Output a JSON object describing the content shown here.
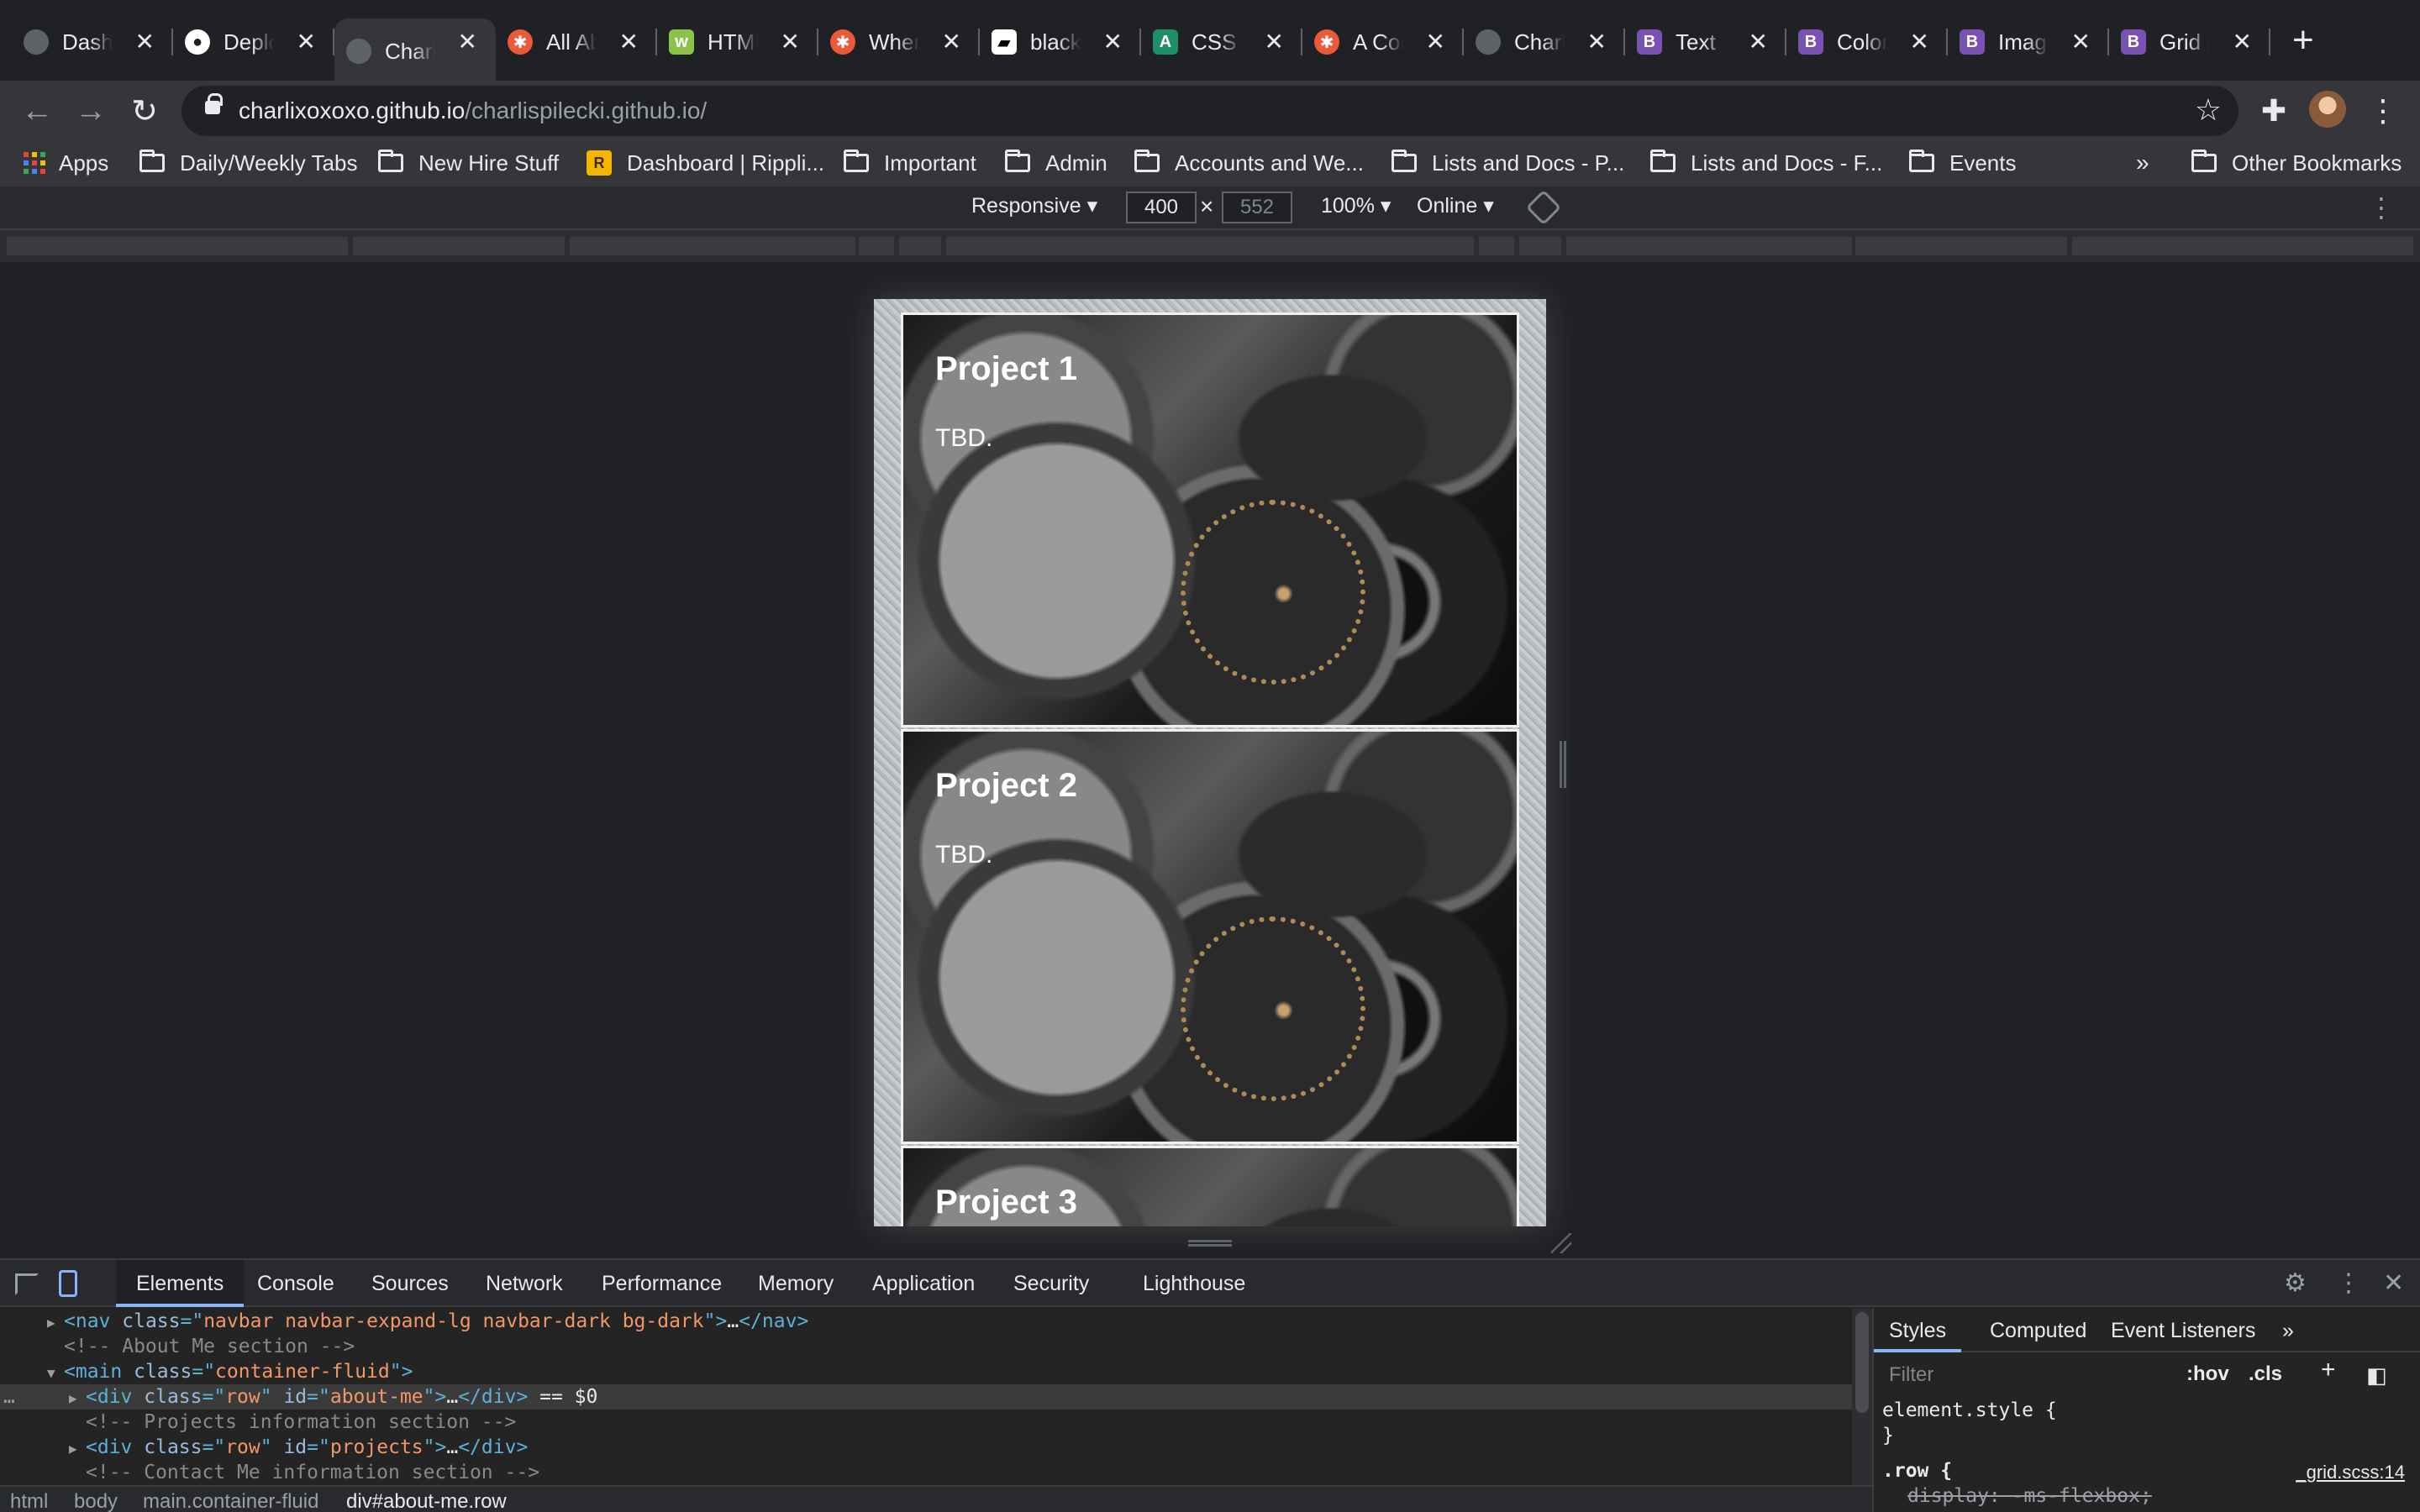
{
  "tabs": [
    {
      "title": "Dashbo",
      "favicon": "globe-icon"
    },
    {
      "title": "Deploy",
      "favicon": "github-icon"
    },
    {
      "title": "Charlie",
      "favicon": "globe-icon",
      "active": true
    },
    {
      "title": "All Abo",
      "favicon": "orange-burst-icon"
    },
    {
      "title": "HTML",
      "favicon": "w3-icon"
    },
    {
      "title": "When",
      "favicon": "orange-burst-icon"
    },
    {
      "title": "black",
      "favicon": "unsplash-icon"
    },
    {
      "title": "CSS b",
      "favicon": "teal-icon"
    },
    {
      "title": "A Com",
      "favicon": "orange-burst-icon"
    },
    {
      "title": "Charlie",
      "favicon": "globe-icon"
    },
    {
      "title": "Text ·",
      "favicon": "bootstrap-icon"
    },
    {
      "title": "Colors",
      "favicon": "bootstrap-icon"
    },
    {
      "title": "Images",
      "favicon": "bootstrap-icon"
    },
    {
      "title": "Grid s",
      "favicon": "bootstrap-icon"
    }
  ],
  "address": {
    "host": "charlixoxoxo.github.io",
    "path": "/charlispilecki.github.io/"
  },
  "bookmarks": {
    "apps": "Apps",
    "items": [
      "Daily/Weekly Tabs",
      "New Hire Stuff",
      "Dashboard | Rippli...",
      "Important",
      "Admin",
      "Accounts and We...",
      "Lists and Docs - P...",
      "Lists and Docs - F...",
      "Events"
    ],
    "overflow": "»",
    "other": "Other Bookmarks"
  },
  "device_toolbar": {
    "mode": "Responsive ▾",
    "width": "400",
    "height": "552",
    "times": "×",
    "zoom": "100% ▾",
    "network": "Online ▾"
  },
  "page": {
    "cards": [
      {
        "title": "Project 1",
        "text": "TBD."
      },
      {
        "title": "Project 2",
        "text": "TBD."
      },
      {
        "title": "Project 3",
        "text": ""
      }
    ]
  },
  "devtools": {
    "tabs": [
      "Elements",
      "Console",
      "Sources",
      "Network",
      "Performance",
      "Memory",
      "Application",
      "Security",
      "Lighthouse"
    ],
    "active_tab": "Elements",
    "dom_lines": [
      {
        "indent": 1,
        "arrow": "▶",
        "html": "nav",
        "parts": [
          [
            "tag",
            "<nav "
          ],
          [
            "attr",
            "class"
          ],
          [
            "tag",
            "=\""
          ],
          [
            "val",
            "navbar navbar-expand-lg navbar-dark bg-dark"
          ],
          [
            "tag",
            "\">"
          ],
          [
            "txt",
            "…"
          ],
          [
            "tag",
            "</nav>"
          ]
        ]
      },
      {
        "indent": 1,
        "arrow": "",
        "parts": [
          [
            "cmt",
            "<!-- About Me section -->"
          ]
        ]
      },
      {
        "indent": 1,
        "arrow": "▼",
        "parts": [
          [
            "tag",
            "<main "
          ],
          [
            "attr",
            "class"
          ],
          [
            "tag",
            "=\""
          ],
          [
            "val",
            "container-fluid"
          ],
          [
            "tag",
            "\">"
          ]
        ]
      },
      {
        "indent": 2,
        "arrow": "▶",
        "selected": true,
        "parts": [
          [
            "tag",
            "<div "
          ],
          [
            "attr",
            "class"
          ],
          [
            "tag",
            "=\""
          ],
          [
            "val",
            "row"
          ],
          [
            "tag",
            "\" "
          ],
          [
            "attr",
            "id"
          ],
          [
            "tag",
            "=\""
          ],
          [
            "val",
            "about-me"
          ],
          [
            "tag",
            "\">"
          ],
          [
            "txt",
            "…"
          ],
          [
            "tag",
            "</div>"
          ],
          [
            "txt",
            " == $0"
          ]
        ]
      },
      {
        "indent": 2,
        "arrow": "",
        "parts": [
          [
            "cmt",
            "<!-- Projects information section -->"
          ]
        ]
      },
      {
        "indent": 2,
        "arrow": "▶",
        "parts": [
          [
            "tag",
            "<div "
          ],
          [
            "attr",
            "class"
          ],
          [
            "tag",
            "=\""
          ],
          [
            "val",
            "row"
          ],
          [
            "tag",
            "\" "
          ],
          [
            "attr",
            "id"
          ],
          [
            "tag",
            "=\""
          ],
          [
            "val",
            "projects"
          ],
          [
            "tag",
            "\">"
          ],
          [
            "txt",
            "…"
          ],
          [
            "tag",
            "</div>"
          ]
        ]
      },
      {
        "indent": 2,
        "arrow": "",
        "parts": [
          [
            "cmt",
            "<!-- Contact Me information section -->"
          ]
        ]
      }
    ],
    "breadcrumbs": [
      "html",
      "body",
      "main.container-fluid",
      "div#about-me.row"
    ],
    "styles": {
      "tabs": [
        "Styles",
        "Computed",
        "Event Listeners",
        "»"
      ],
      "filter_placeholder": "Filter",
      "hov": ":hov",
      "cls": ".cls",
      "element_style_open": "element.style {",
      "element_style_close": "}",
      "rule_selector": ".row {",
      "rule_prop": "display: -ms-flexbox;",
      "rule_source": "_grid.scss:14"
    }
  }
}
